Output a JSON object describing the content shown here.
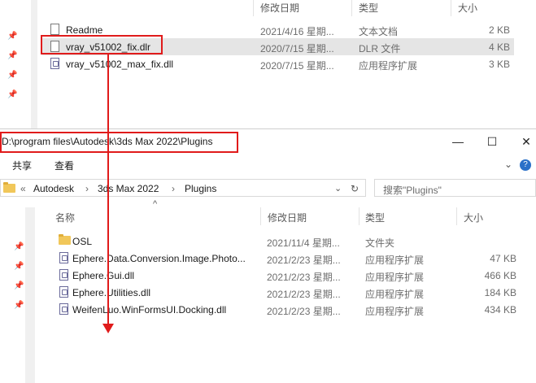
{
  "top_window": {
    "headers": {
      "modified": "修改日期",
      "type": "类型",
      "size": "大小"
    },
    "files": [
      {
        "name": "Readme",
        "modified": "2021/4/16 星期...",
        "type": "文本文档",
        "size": "2 KB",
        "icon": "text-file-icon"
      },
      {
        "name": "vray_v51002_fix.dlr",
        "modified": "2020/7/15 星期...",
        "type": "DLR 文件",
        "size": "4 KB",
        "icon": "file-icon"
      },
      {
        "name": "vray_v51002_max_fix.dll",
        "modified": "2020/7/15 星期...",
        "type": "应用程序扩展",
        "size": "3 KB",
        "icon": "dll-file-icon"
      }
    ]
  },
  "bottom_window": {
    "title_path": "D:\\program files\\Autodesk\\3ds Max 2022\\Plugins",
    "controls": {
      "minimize": "—",
      "maximize": "☐",
      "close": "✕"
    },
    "ribbon": {
      "share": "共享",
      "view": "查看",
      "expand": "⌄",
      "help": "?"
    },
    "breadcrumb": {
      "overflow": "«",
      "items": [
        "Autodesk",
        "3ds Max 2022",
        "Plugins"
      ],
      "sep": "›"
    },
    "search_placeholder": "搜索\"Plugins\"",
    "headers": {
      "name": "名称",
      "modified": "修改日期",
      "type": "类型",
      "size": "大小",
      "sort": "^"
    },
    "files": [
      {
        "name": "OSL",
        "modified": "2021/11/4 星期...",
        "type": "文件夹",
        "size": "",
        "icon": "folder-icon"
      },
      {
        "name": "Ephere.Data.Conversion.Image.Photo...",
        "modified": "2021/2/23 星期...",
        "type": "应用程序扩展",
        "size": "47 KB",
        "icon": "dll-file-icon"
      },
      {
        "name": "Ephere.Gui.dll",
        "modified": "2021/2/23 星期...",
        "type": "应用程序扩展",
        "size": "466 KB",
        "icon": "dll-file-icon"
      },
      {
        "name": "Ephere.Utilities.dll",
        "modified": "2021/2/23 星期...",
        "type": "应用程序扩展",
        "size": "184 KB",
        "icon": "dll-file-icon"
      },
      {
        "name": "WeifenLuo.WinFormsUI.Docking.dll",
        "modified": "2021/2/23 星期...",
        "type": "应用程序扩展",
        "size": "434 KB",
        "icon": "dll-file-icon"
      }
    ]
  },
  "annotation_color": "#e01b1b"
}
